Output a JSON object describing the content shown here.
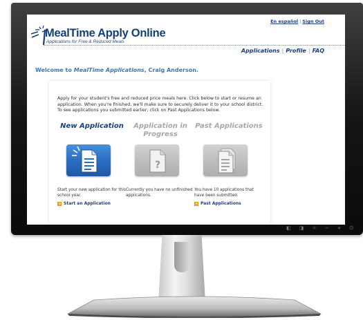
{
  "top_links": {
    "spanish": "En español",
    "sign_out": "Sign Out"
  },
  "logo": {
    "title": "MealTime Apply Online",
    "subtitle": "Applications for Free & Reduced Meals"
  },
  "nav": {
    "items": [
      "Applications",
      "Profile",
      "FAQ"
    ]
  },
  "welcome": {
    "prefix": "Welcome to ",
    "app_name": "MealTime Applications",
    "suffix": ", Craig Anderson."
  },
  "intro": "Apply for your student's free and reduced price meals here. Click below to start or resume an application. When you're finished, we'll make sure to securely deliver it to your school district. To see applications you submitted earlier, click on Past Applications below.",
  "columns": [
    {
      "title": "New Application",
      "state": "active",
      "icon": "new-document-icon",
      "description": "Start your new application for this school year.",
      "link": "Start an Application"
    },
    {
      "title": "Application in Progress",
      "state": "inactive",
      "icon": "question-document-icon",
      "description": "Currently you have no unfinished applications.",
      "link": ""
    },
    {
      "title": "Past Applications",
      "state": "inactive",
      "icon": "stacked-documents-icon",
      "description": "You have 10 applications that have been submitted.",
      "link": "Past Applications"
    }
  ],
  "colors": {
    "navy": "#153f7c",
    "link_blue": "#1f3e7a",
    "welcome_blue": "#3f77b4",
    "tile_blue": "#2a6cc0",
    "tile_gray": "#bdbdbd",
    "arrow_orange": "#f0b339"
  },
  "monitor_controls": [
    "input-icon",
    "menu-icon",
    "brightness-icon",
    "minus-icon",
    "plus-icon",
    "power-icon"
  ]
}
